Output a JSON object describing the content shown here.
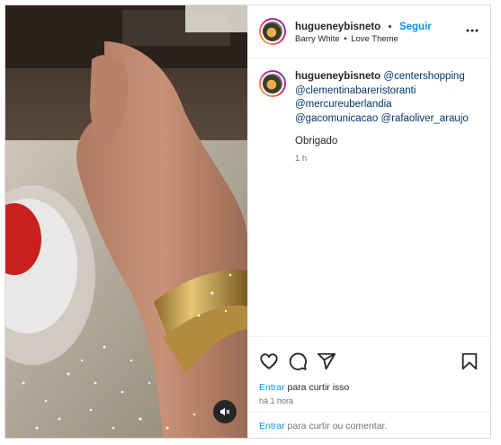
{
  "post": {
    "username": "hugueneybisneto",
    "separator": "•",
    "follow_label": "Seguir",
    "audio": {
      "artist": "Barry White",
      "separator": "•",
      "track": "Love Theme"
    },
    "more_icon": "more-horizontal-icon"
  },
  "caption": {
    "username": "hugueneybisneto",
    "mentions": [
      "@centershopping",
      "@clementinabareristoranti",
      "@mercureuberlandia",
      "@gacomunicacao",
      "@rafaoliver_araujo"
    ],
    "text": "Obrigado",
    "time": "1 h"
  },
  "actions": {
    "icons": [
      "heart-icon",
      "comment-icon",
      "share-icon",
      "bookmark-icon"
    ],
    "like_login": "Entrar",
    "like_rest": " para curtir isso",
    "posted": "há 1 hora"
  },
  "comment": {
    "login": "Entrar",
    "rest": " para curtir ou comentar."
  },
  "media": {
    "mute_icon": "speaker-muted-icon"
  },
  "colors": {
    "accent": "#0095f6",
    "mention": "#00376b",
    "text": "#262626",
    "muted": "#737373",
    "border": "#dbdbdb"
  }
}
